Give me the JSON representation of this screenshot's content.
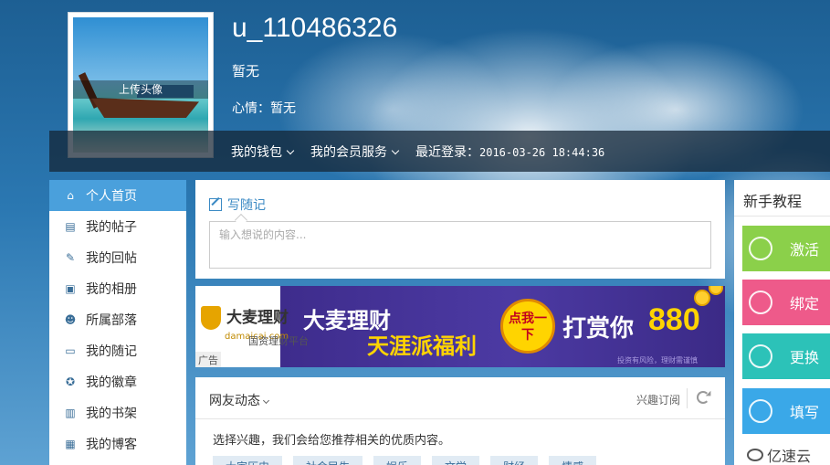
{
  "profile": {
    "upload_avatar": "上传头像",
    "username": "u_110486326",
    "subtitle": "暂无",
    "mood_label": "心情：",
    "mood_value": "暂无",
    "wallet": "我的钱包",
    "member_service": "我的会员服务",
    "last_login_label": "最近登录：",
    "last_login_time": "2016-03-26 18:44:36"
  },
  "sidebar": {
    "items": [
      {
        "label": "个人首页",
        "icon": "home-icon",
        "active": true
      },
      {
        "label": "我的帖子",
        "icon": "document-icon"
      },
      {
        "label": "我的回帖",
        "icon": "edit-icon"
      },
      {
        "label": "我的相册",
        "icon": "photo-icon"
      },
      {
        "label": "所属部落",
        "icon": "group-icon"
      },
      {
        "label": "我的随记",
        "icon": "note-icon"
      },
      {
        "label": "我的徽章",
        "icon": "badge-icon"
      },
      {
        "label": "我的书架",
        "icon": "book-icon"
      },
      {
        "label": "我的博客",
        "icon": "blog-icon"
      }
    ]
  },
  "post": {
    "write_label": "写随记",
    "placeholder": "输入想说的内容..."
  },
  "ad": {
    "brand": "大麦理财",
    "brand_url": "damaicai.com",
    "platform": "国资理财平台",
    "headline1": "大麦理财",
    "headline2": "天涯派福利",
    "badge": "点我一下",
    "reward": "打赏你",
    "amount": "880",
    "disclaimer": "投资有风险，理财需谨慎",
    "tag": "广告"
  },
  "feed": {
    "title": "网友动态",
    "subscribe": "兴趣订阅",
    "description": "选择兴趣，我们会给您推荐相关的优质内容。",
    "tags": [
      "大家历史",
      "社会民生",
      "娱乐",
      "文学",
      "财经",
      "情感"
    ]
  },
  "guide": {
    "title": "新手教程",
    "cards": [
      {
        "label": "激活",
        "color": "#8bd04a",
        "icon": "phone-icon"
      },
      {
        "label": "绑定",
        "color": "#ee5a8a",
        "icon": "mail-icon"
      },
      {
        "label": "更换",
        "color": "#2cc2b8",
        "icon": "user-icon"
      },
      {
        "label": "填写",
        "color": "#3aa8e8",
        "icon": "form-icon"
      }
    ]
  },
  "watermark": "亿速云"
}
